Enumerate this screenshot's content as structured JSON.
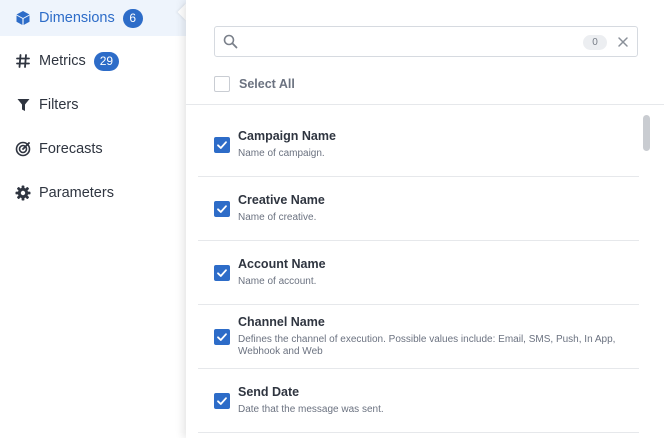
{
  "sidebar": {
    "items": [
      {
        "label": "Dimensions",
        "badge": "6",
        "icon": "cube-icon",
        "active": true
      },
      {
        "label": "Metrics",
        "badge": "29",
        "icon": "hash-icon",
        "active": false
      },
      {
        "label": "Filters",
        "icon": "filter-icon",
        "active": false
      },
      {
        "label": "Forecasts",
        "icon": "forecast-icon",
        "active": false
      },
      {
        "label": "Parameters",
        "icon": "gear-icon",
        "active": false
      }
    ]
  },
  "search": {
    "value": "",
    "placeholder": "",
    "selected_count": "0"
  },
  "select_all": {
    "label": "Select All",
    "checked": false
  },
  "dimensions": [
    {
      "name": "Campaign Name",
      "description": "Name of campaign.",
      "checked": true
    },
    {
      "name": "Creative Name",
      "description": "Name of creative.",
      "checked": true
    },
    {
      "name": "Account Name",
      "description": "Name of account.",
      "checked": true
    },
    {
      "name": "Channel Name",
      "description": "Defines the channel of execution. Possible values include: Email, SMS, Push, In App, Webhook and Web",
      "checked": true
    },
    {
      "name": "Send Date",
      "description": "Date that the message was sent.",
      "checked": true
    }
  ],
  "colors": {
    "accent": "#2d6cc8",
    "active_bg": "#eef4fc"
  }
}
